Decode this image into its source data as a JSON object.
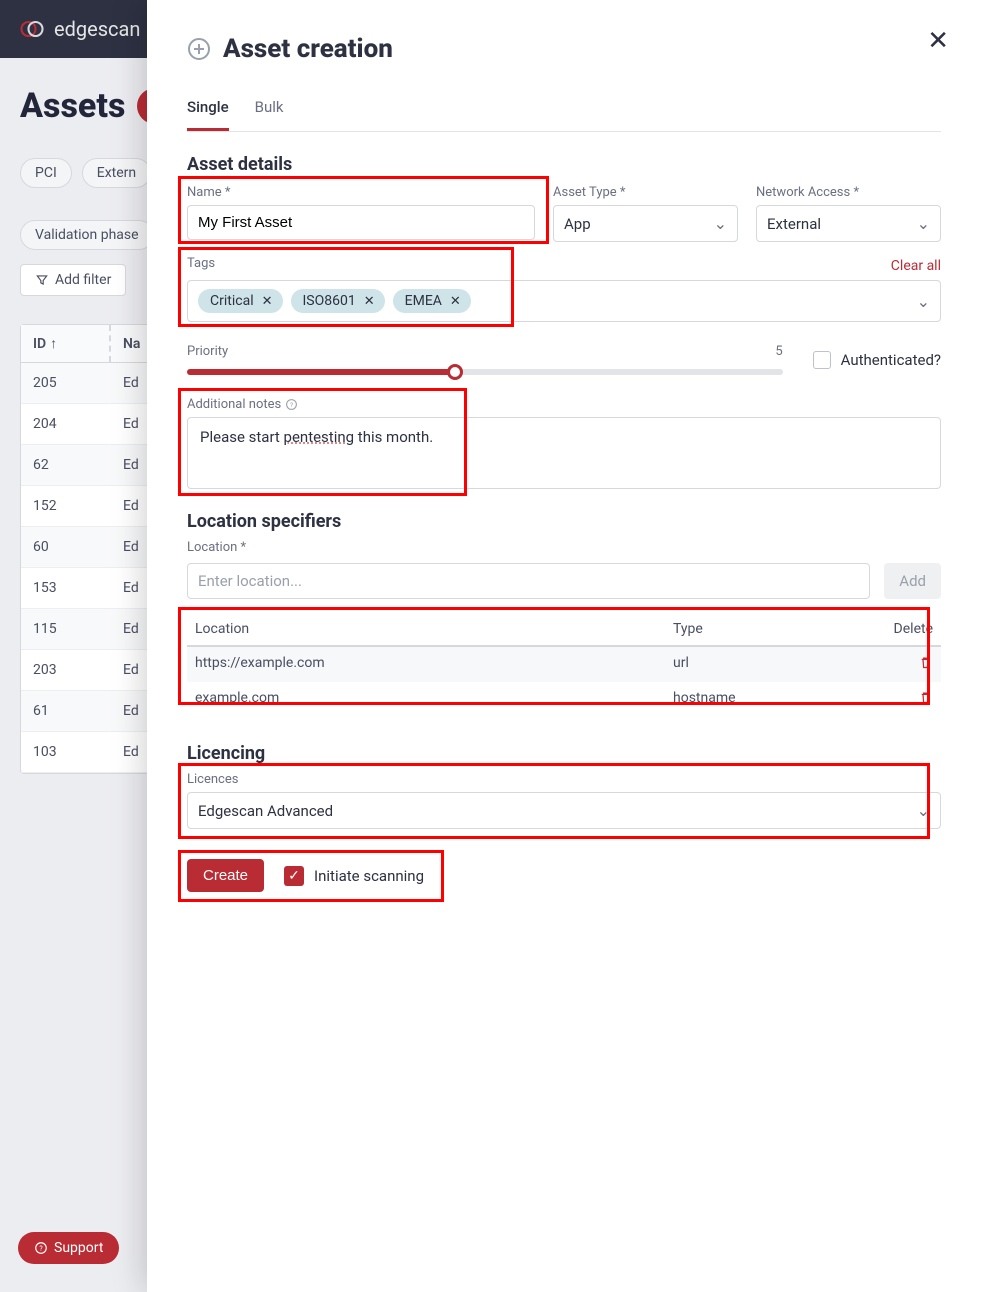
{
  "brand": "edgescan",
  "page": {
    "title": "Assets",
    "filters": [
      "PCI",
      "Extern",
      "Validation phase"
    ],
    "add_filter": "Add filter",
    "table": {
      "id_header": "ID",
      "name_header": "Na",
      "rows": [
        {
          "id": "205",
          "name": "Ed"
        },
        {
          "id": "204",
          "name": "Ed"
        },
        {
          "id": "62",
          "name": "Ed"
        },
        {
          "id": "152",
          "name": "Ed"
        },
        {
          "id": "60",
          "name": "Ed"
        },
        {
          "id": "153",
          "name": "Ed"
        },
        {
          "id": "115",
          "name": "Ed"
        },
        {
          "id": "203",
          "name": "Ed"
        },
        {
          "id": "61",
          "name": "Ed"
        },
        {
          "id": "103",
          "name": "Ed"
        }
      ]
    }
  },
  "support_label": "Support",
  "modal": {
    "title": "Asset creation",
    "tabs": {
      "single": "Single",
      "bulk": "Bulk"
    },
    "details": {
      "heading": "Asset details",
      "name_label": "Name *",
      "name_value": "My First Asset",
      "asset_type_label": "Asset Type *",
      "asset_type_value": "App",
      "network_label": "Network Access *",
      "network_value": "External",
      "tags_label": "Tags",
      "clear_all": "Clear all",
      "tags": [
        "Critical",
        "ISO8601",
        "EMEA"
      ],
      "priority_label": "Priority",
      "priority_value": "5",
      "auth_label": "Authenticated?",
      "notes_label": "Additional notes",
      "notes_pre": "Please start ",
      "notes_span": "pentesting",
      "notes_post": " this month."
    },
    "location": {
      "heading": "Location specifiers",
      "label": "Location *",
      "placeholder": "Enter location...",
      "add": "Add",
      "cols": {
        "loc": "Location",
        "type": "Type",
        "del": "Delete"
      },
      "rows": [
        {
          "loc": "https://example.com",
          "type": "url"
        },
        {
          "loc": "example.com",
          "type": "hostname"
        }
      ]
    },
    "licence": {
      "heading": "Licencing",
      "label": "Licences",
      "value": "Edgescan Advanced"
    },
    "actions": {
      "create": "Create",
      "initiate": "Initiate scanning"
    }
  }
}
